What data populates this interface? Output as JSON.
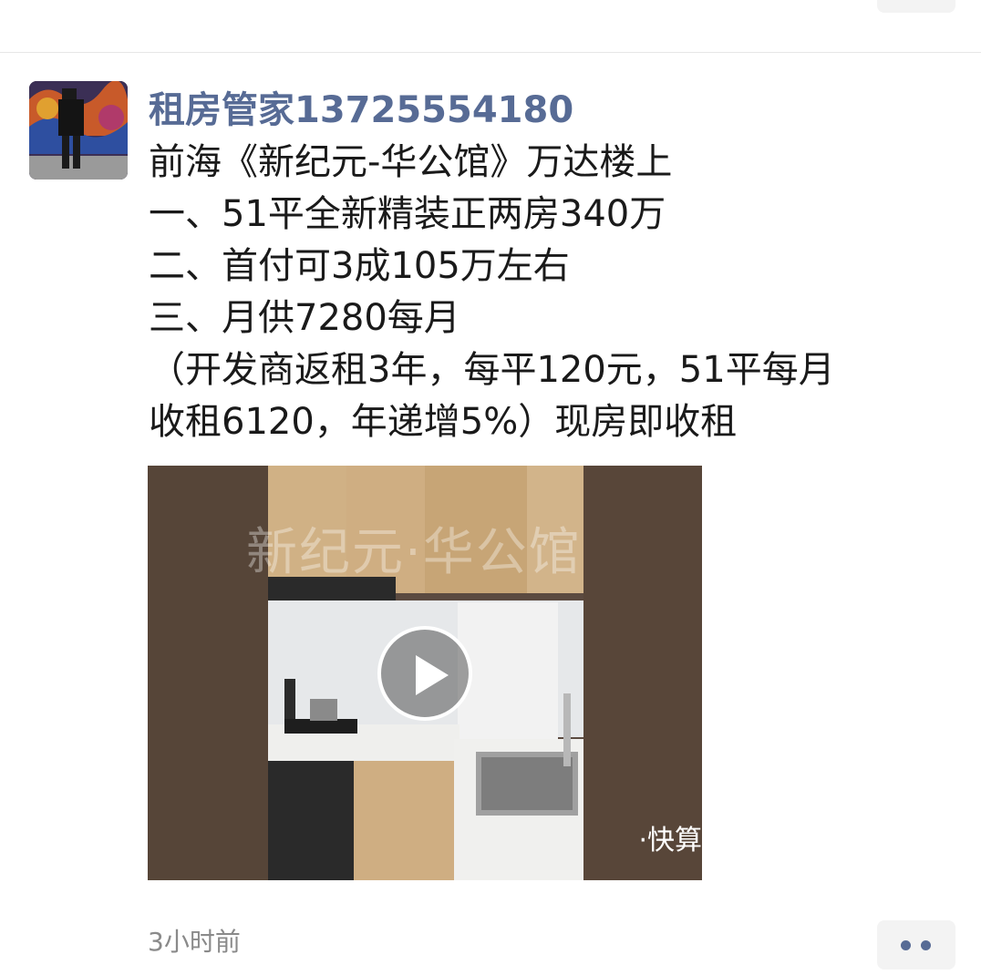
{
  "post": {
    "author": "租房管家13725554180",
    "lines": [
      "前海《新纪元-华公馆》万达楼上",
      "一、51平全新精装正两房340万",
      "二、首付可3成105万左右",
      "三、月供7280每月",
      "（开发商返租3年，每平120元，51平每月",
      "收租6120，年递增5%）现房即收租"
    ],
    "video": {
      "watermark": "新纪元·华公馆",
      "brand": "·快算"
    },
    "timestamp": "3小时前"
  },
  "icons": {
    "avatar": "avatar-image",
    "play": "play-icon",
    "more": "more-dots-icon"
  },
  "colors": {
    "author_link": "#576b95",
    "text": "#1a1a1a",
    "timestamp": "#8a8a8a",
    "more_button_bg": "#f3f3f3"
  }
}
